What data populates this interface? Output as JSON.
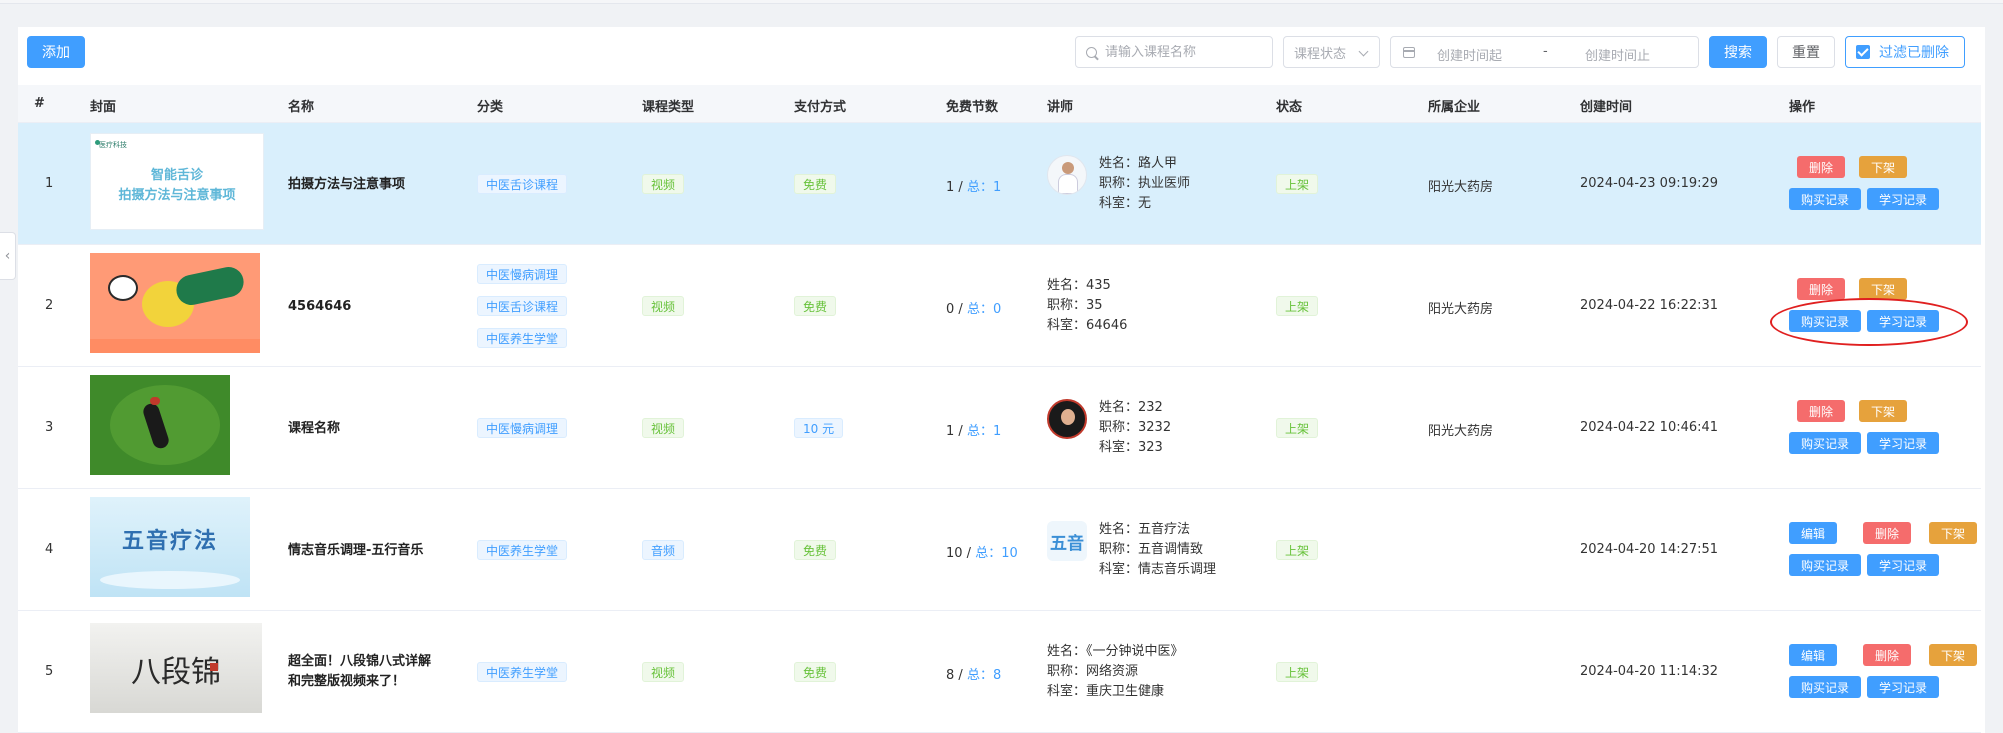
{
  "toolbar": {
    "add_label": "添加",
    "search_placeholder": "请输入课程名称",
    "status_placeholder": "课程状态",
    "date_start_placeholder": "创建时间起",
    "date_sep": "-",
    "date_end_placeholder": "创建时间止",
    "search_label": "搜索",
    "reset_label": "重置",
    "filter_deleted_label": "过滤已删除",
    "filter_deleted_checked": true
  },
  "columns": [
    "#",
    "封面",
    "名称",
    "分类",
    "课程类型",
    "支付方式",
    "免费节数",
    "讲师",
    "状态",
    "所属企业",
    "创建时间",
    "操作"
  ],
  "lecturer_labels": {
    "name": "姓名：",
    "title": "职称：",
    "dept": "科室："
  },
  "rows": [
    {
      "index": "1",
      "cover_text": [
        "智能舌诊",
        "拍摄方法与注意事项"
      ],
      "cover_logo": "医疗科技",
      "name": "拍摄方法与注意事项",
      "categories": [
        "中医舌诊课程"
      ],
      "course_type": "视频",
      "payment": "免费",
      "free_count": "1",
      "total_label": "总：",
      "total": "1",
      "lecturer": {
        "name": "路人甲",
        "title": "执业医师",
        "dept": "无"
      },
      "status": "上架",
      "enterprise": "阳光大药房",
      "created": "2024-04-23 09:19:29",
      "actions": [
        "删除",
        "下架",
        "购买记录",
        "学习记录"
      ]
    },
    {
      "index": "2",
      "name": "4564646",
      "categories": [
        "中医慢病调理",
        "中医舌诊课程",
        "中医养生学堂"
      ],
      "course_type": "视频",
      "payment": "免费",
      "free_count": "0",
      "total_label": "总：",
      "total": "0",
      "lecturer": {
        "name": "435",
        "title": "35",
        "dept": "64646"
      },
      "status": "上架",
      "enterprise": "阳光大药房",
      "created": "2024-04-22 16:22:31",
      "actions": [
        "删除",
        "下架",
        "购买记录",
        "学习记录"
      ]
    },
    {
      "index": "3",
      "name": "课程名称",
      "categories": [
        "中医慢病调理"
      ],
      "course_type": "视频",
      "payment": "10 元",
      "free_count": "1",
      "total_label": "总：",
      "total": "1",
      "lecturer": {
        "name": "232",
        "title": "3232",
        "dept": "323"
      },
      "status": "上架",
      "enterprise": "阳光大药房",
      "created": "2024-04-22 10:46:41",
      "actions": [
        "删除",
        "下架",
        "购买记录",
        "学习记录"
      ]
    },
    {
      "index": "4",
      "cover_text": [
        "五音疗法"
      ],
      "avatar_text": "五音",
      "name": "情志音乐调理-五行音乐",
      "categories": [
        "中医养生学堂"
      ],
      "course_type": "音频",
      "payment": "免费",
      "free_count": "10",
      "total_label": "总：",
      "total": "10",
      "lecturer": {
        "name": "五音疗法",
        "title": "五音调情致",
        "dept": "情志音乐调理"
      },
      "status": "上架",
      "enterprise": "",
      "created": "2024-04-20 14:27:51",
      "actions": [
        "编辑",
        "删除",
        "下架",
        "购买记录",
        "学习记录"
      ]
    },
    {
      "index": "5",
      "cover_text": [
        "八段锦"
      ],
      "name_lines": [
        "超全面！八段锦八式详解",
        "和完整版视频来了！"
      ],
      "categories": [
        "中医养生学堂"
      ],
      "course_type": "视频",
      "payment": "免费",
      "free_count": "8",
      "total_label": "总：",
      "total": "8",
      "lecturer": {
        "name": "《一分钟说中医》",
        "title": "网络资源",
        "dept": "重庆卫生健康"
      },
      "status": "上架",
      "enterprise": "",
      "created": "2024-04-20 11:14:32",
      "actions": [
        "编辑",
        "删除",
        "下架",
        "购买记录",
        "学习记录"
      ]
    }
  ],
  "colors": {
    "primary": "#409eff",
    "danger": "#f56c6c",
    "warning": "#e6a23c",
    "success": "#67c23a",
    "highlight_row": "#d9effc",
    "annotation": "#e02020"
  }
}
